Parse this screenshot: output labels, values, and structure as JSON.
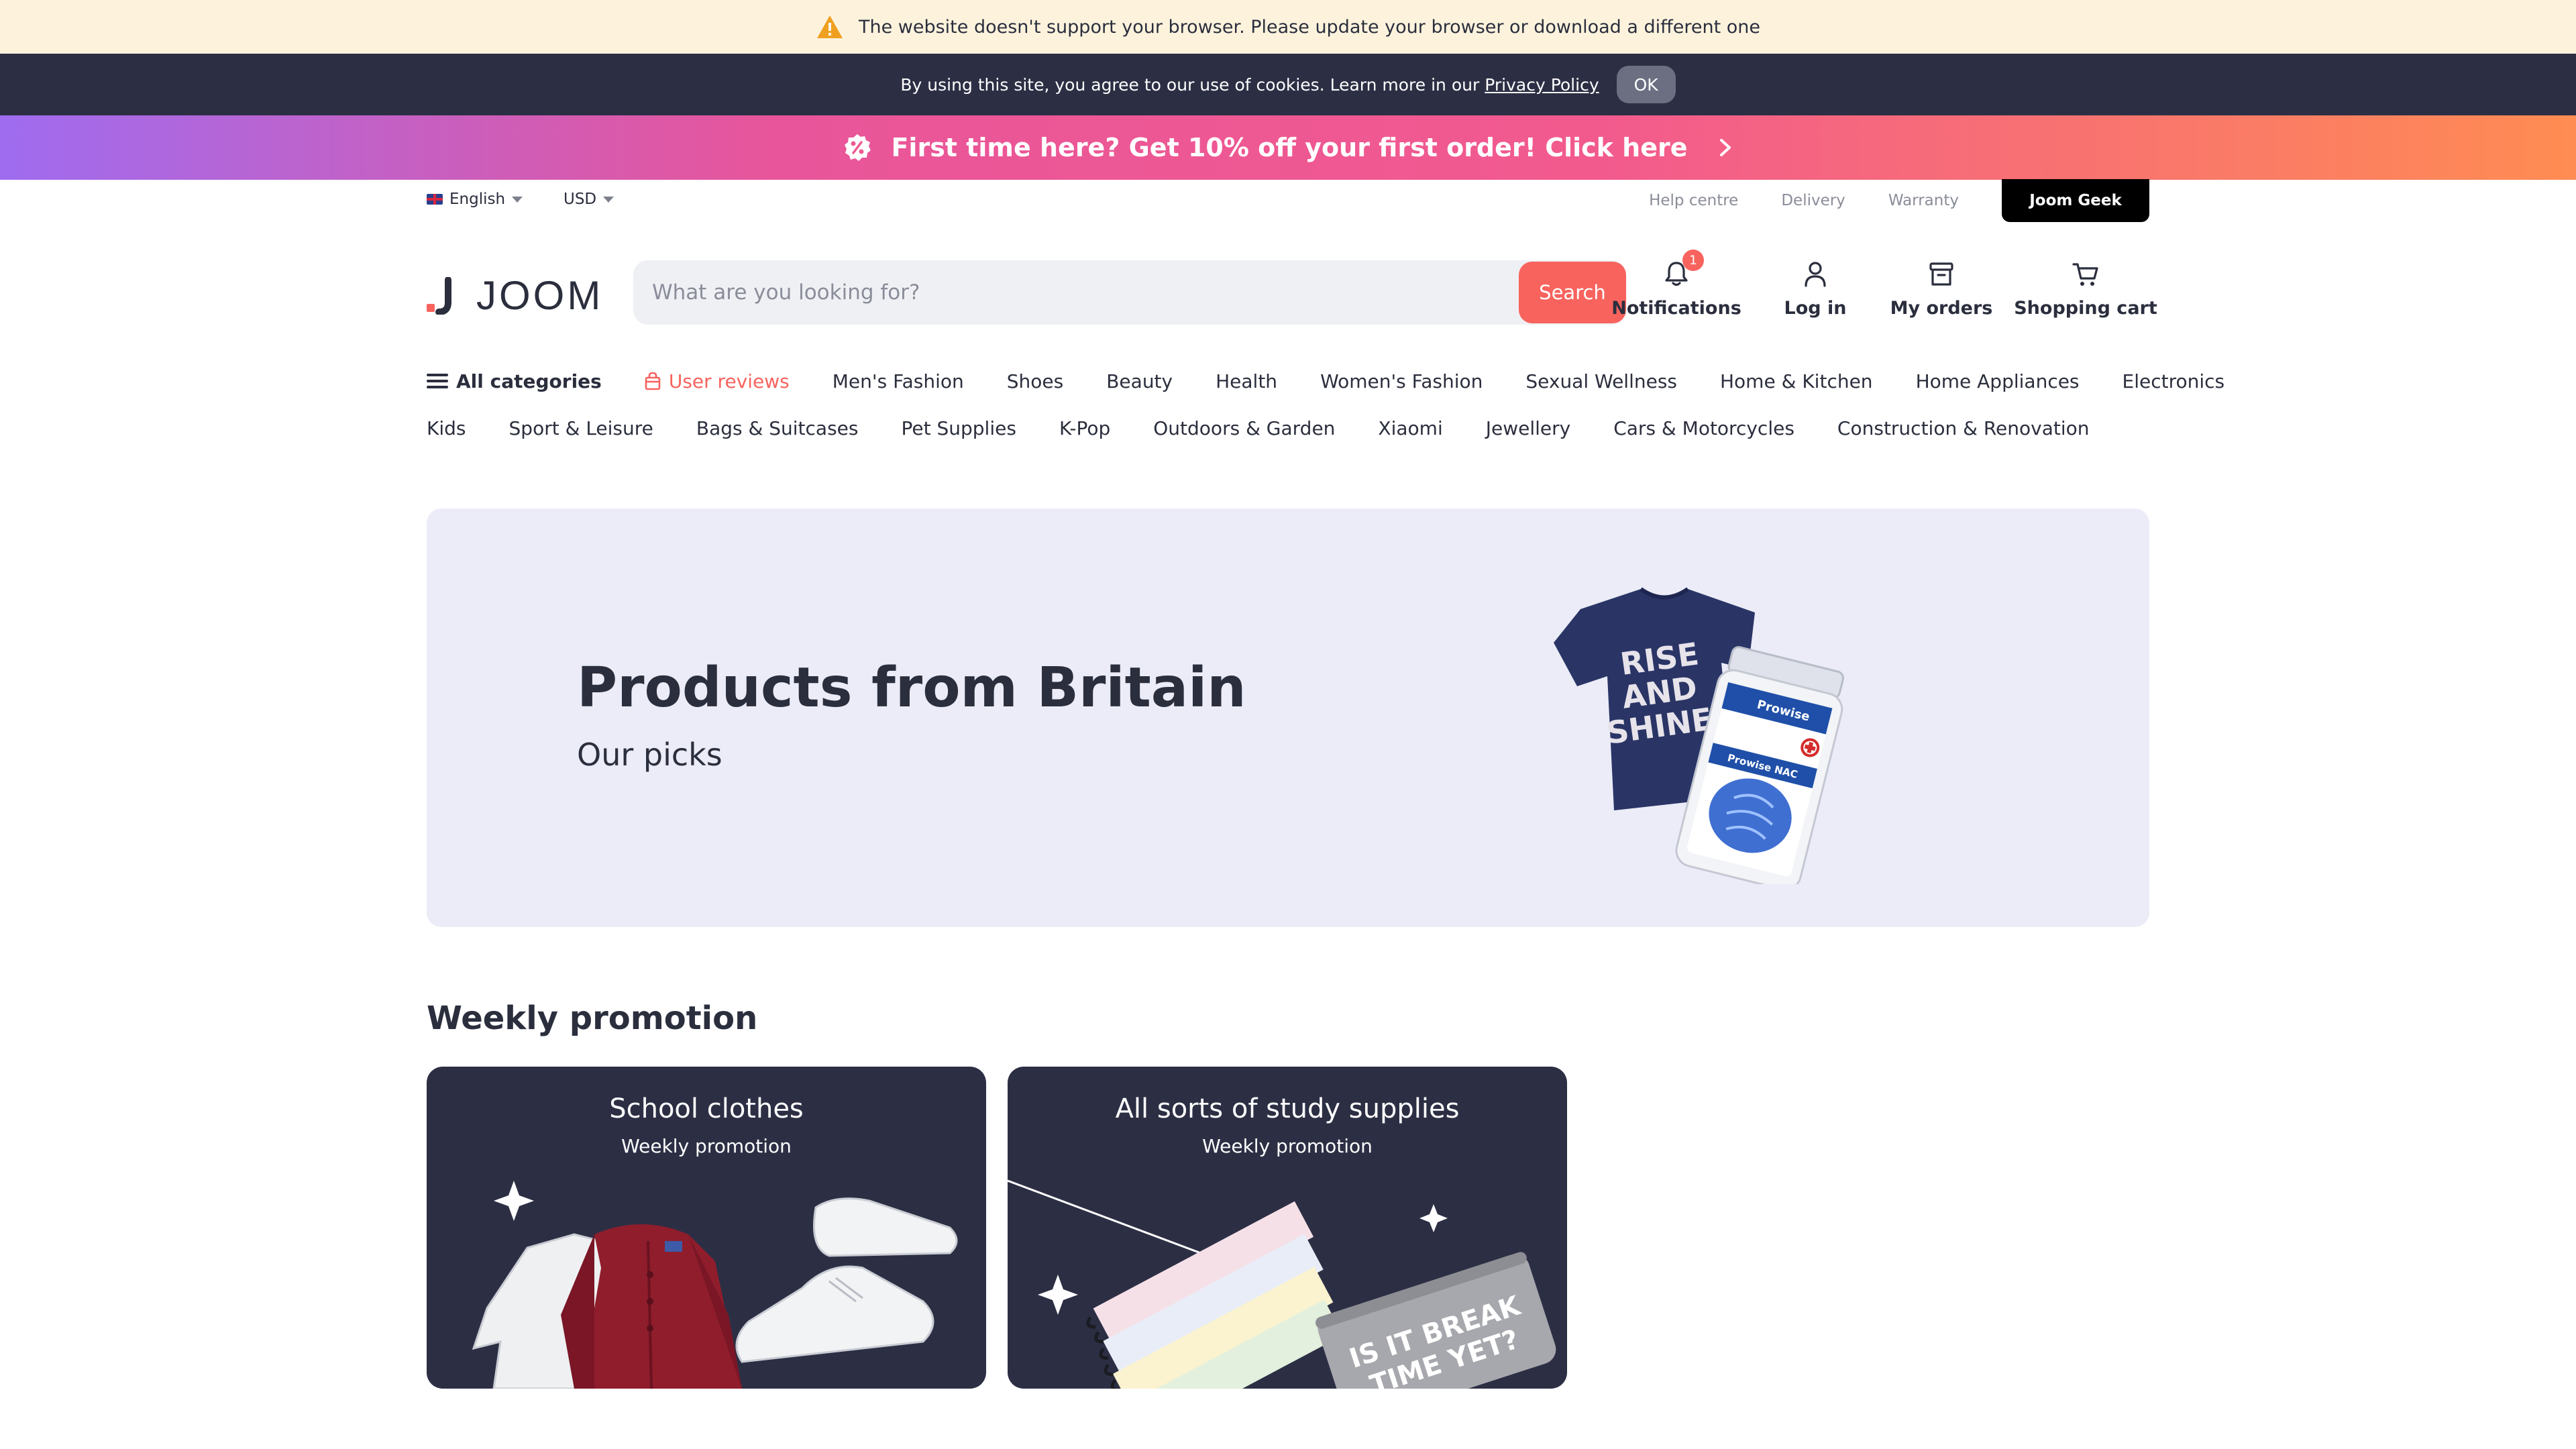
{
  "warning_bar": {
    "icon": "warning-icon",
    "text": "The website doesn't support your browser. Please update your browser or download a different one"
  },
  "cookie_bar": {
    "text": "By using this site, you agree to our use of cookies. Learn more in our",
    "link": "Privacy Policy",
    "ok_label": "OK"
  },
  "promo_bar": {
    "icon": "discount-badge-icon",
    "text": "First time here? Get 10% off your first order! Click here",
    "chevron": "chevron-right-icon"
  },
  "utility": {
    "language": "English",
    "currency": "USD",
    "links": [
      "Help centre",
      "Delivery",
      "Warranty"
    ],
    "geek_label": "Joom Geek"
  },
  "header": {
    "logo_text": "JOOM",
    "search_placeholder": "What are you looking for?",
    "search_button": "Search",
    "actions": {
      "notifications": "Notifications",
      "notifications_badge": "1",
      "login": "Log in",
      "orders": "My orders",
      "cart": "Shopping cart"
    }
  },
  "categories": {
    "all": "All categories",
    "reviews": "User reviews",
    "row1": [
      "Men's Fashion",
      "Shoes",
      "Beauty",
      "Health",
      "Women's Fashion",
      "Sexual Wellness",
      "Home & Kitchen",
      "Home Appliances",
      "Electronics"
    ],
    "row2": [
      "Kids",
      "Sport & Leisure",
      "Bags & Suitcases",
      "Pet Supplies",
      "K-Pop",
      "Outdoors & Garden",
      "Xiaomi",
      "Jewellery",
      "Cars & Motorcycles",
      "Construction & Renovation"
    ]
  },
  "hero": {
    "title": "Products from Britain",
    "subtitle": "Our picks",
    "shirt_text": [
      "RISE",
      "AND",
      "SHINE"
    ],
    "bottle_brand": "Prowise",
    "bottle_label": "Prowise NAC"
  },
  "weekly": {
    "title": "Weekly promotion",
    "cards": [
      {
        "title": "School clothes",
        "subtitle": "Weekly promotion"
      },
      {
        "title": "All sorts of study supplies",
        "subtitle": "Weekly promotion",
        "pouch_text": [
          "IS IT BREAK",
          "TIME YET?"
        ]
      }
    ]
  },
  "colors": {
    "accent": "#f8635e",
    "dark": "#2c2f44",
    "warning_bg": "#fdf3dd",
    "hero_bg": "#ebecf7"
  }
}
